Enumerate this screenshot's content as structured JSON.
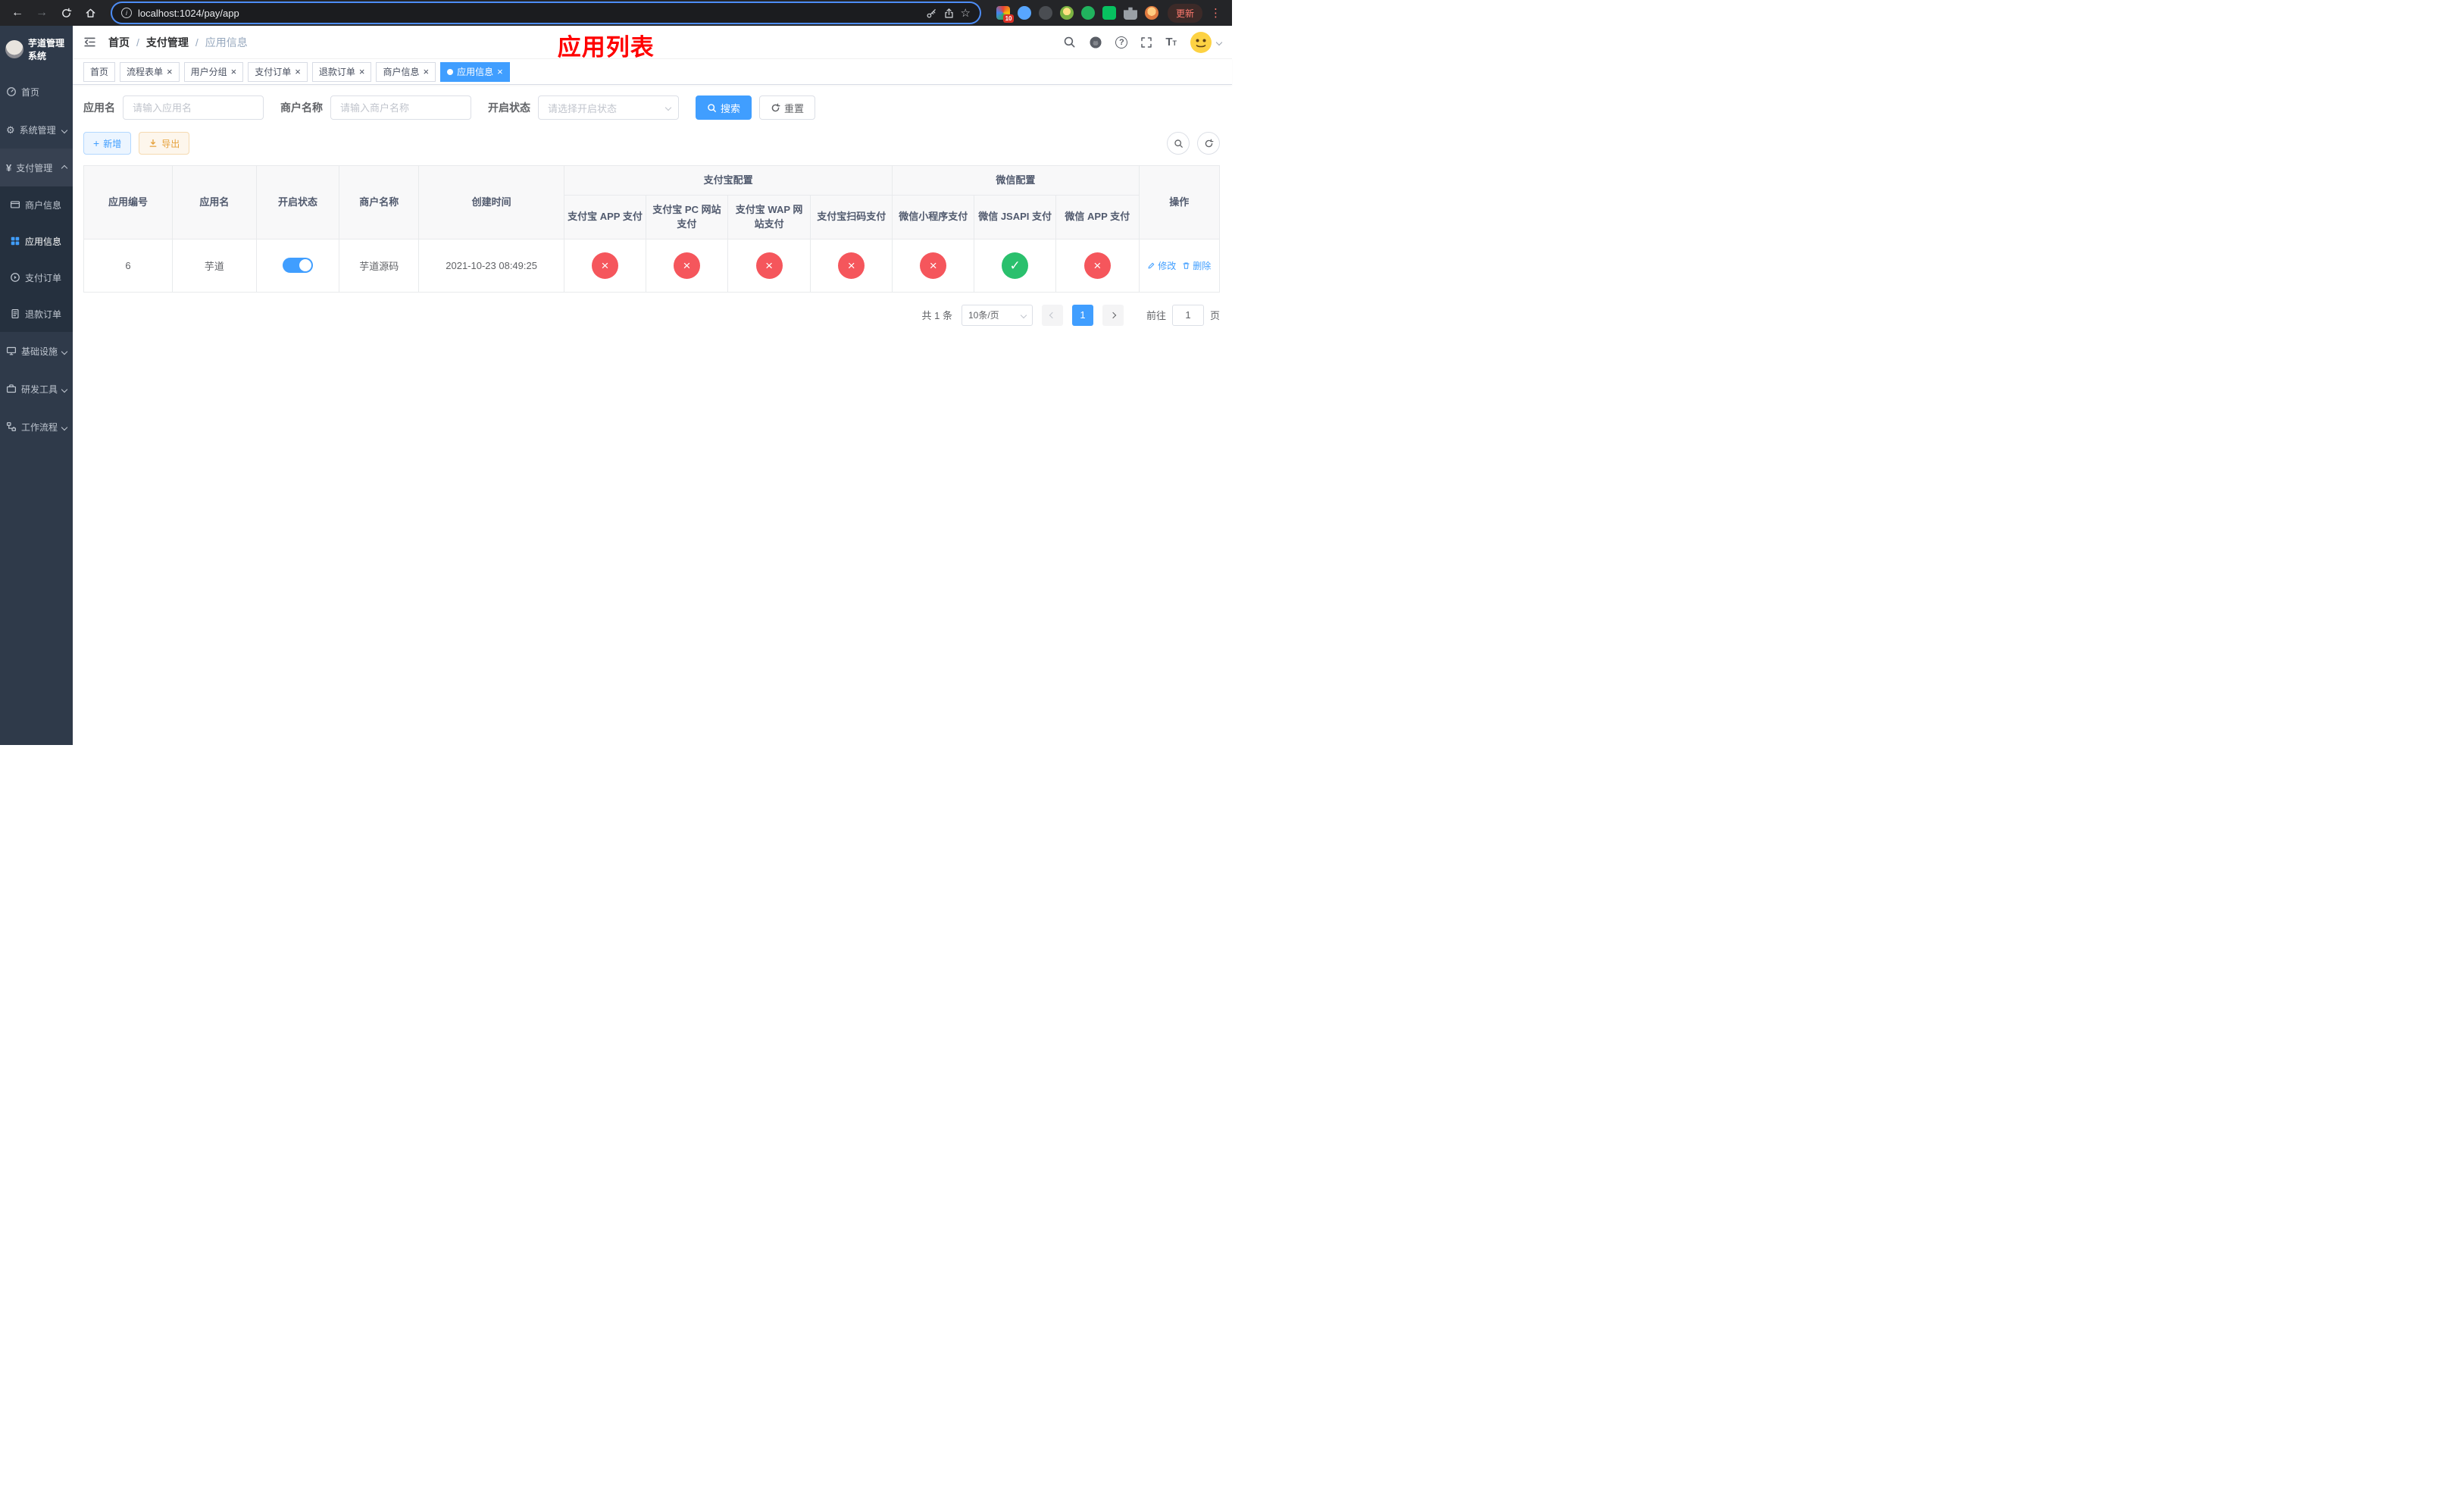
{
  "colors": {
    "accent": "#409eff",
    "success": "#2ac06d",
    "danger": "#f5565c",
    "warning": "#e6a23c",
    "annotation": "#ff0000",
    "sidebar-bg": "#2f3a4a",
    "submenu-bg": "#25303e"
  },
  "icons": {
    "close": "×",
    "check": "✓",
    "cross": "×",
    "star": "☆",
    "back": "←",
    "forward": "→",
    "kebab": "⋮",
    "gear": "⚙",
    "yen": "¥",
    "plus": "+",
    "info": "i",
    "question": "?",
    "font_big": "T",
    "font_small": "T"
  },
  "browser": {
    "url": "localhost:1024/pay/app",
    "update_label": "更新",
    "extension_badge": "10"
  },
  "sidebar": {
    "app_title": "芋道管理系统",
    "items": {
      "home": "首页",
      "system": "系统管理",
      "pay": "支付管理",
      "infra": "基础设施",
      "dev": "研发工具",
      "flow": "工作流程"
    },
    "pay_children": {
      "merchant": "商户信息",
      "app": "应用信息",
      "order": "支付订单",
      "refund": "退款订单"
    }
  },
  "topbar": {
    "breadcrumb": [
      "首页",
      "支付管理",
      "应用信息"
    ],
    "separator": "/",
    "page_title": "应用列表"
  },
  "tabs": [
    {
      "label": "首页"
    },
    {
      "label": "流程表单"
    },
    {
      "label": "用户分组"
    },
    {
      "label": "支付订单"
    },
    {
      "label": "退款订单"
    },
    {
      "label": "商户信息"
    },
    {
      "label": "应用信息"
    }
  ],
  "filters": {
    "app_name_label": "应用名",
    "app_name_placeholder": "请输入应用名",
    "merchant_label": "商户名称",
    "merchant_placeholder": "请输入商户名称",
    "status_label": "开启状态",
    "status_placeholder": "请选择开启状态",
    "search_label": "搜索",
    "reset_label": "重置"
  },
  "toolbar": {
    "add_label": "新增",
    "export_label": "导出"
  },
  "table": {
    "groups": {
      "alipay": "支付宝配置",
      "wechat": "微信配置"
    },
    "headers": {
      "id": "应用编号",
      "name": "应用名",
      "status": "开启状态",
      "merchant": "商户名称",
      "created": "创建时间",
      "alipay_app": "支付宝 APP 支付",
      "alipay_pc": "支付宝 PC 网站支付",
      "alipay_wap": "支付宝 WAP 网站支付",
      "alipay_qr": "支付宝扫码支付",
      "wx_lite": "微信小程序支付",
      "wx_jsapi": "微信 JSAPI 支付",
      "wx_app": "微信 APP 支付",
      "actions": "操作"
    },
    "row": {
      "id": "6",
      "name": "芋道",
      "enabled": true,
      "merchant": "芋道源码",
      "created": "2021-10-23 08:49:25",
      "statuses": [
        "no",
        "no",
        "no",
        "no",
        "no",
        "yes",
        "no"
      ],
      "edit_label": "修改",
      "delete_label": "删除"
    }
  },
  "pagination": {
    "total": "共 1 条",
    "page_size": "10条/页",
    "page": "1",
    "goto_label": "前往",
    "goto_value": "1",
    "unit_label": "页"
  }
}
